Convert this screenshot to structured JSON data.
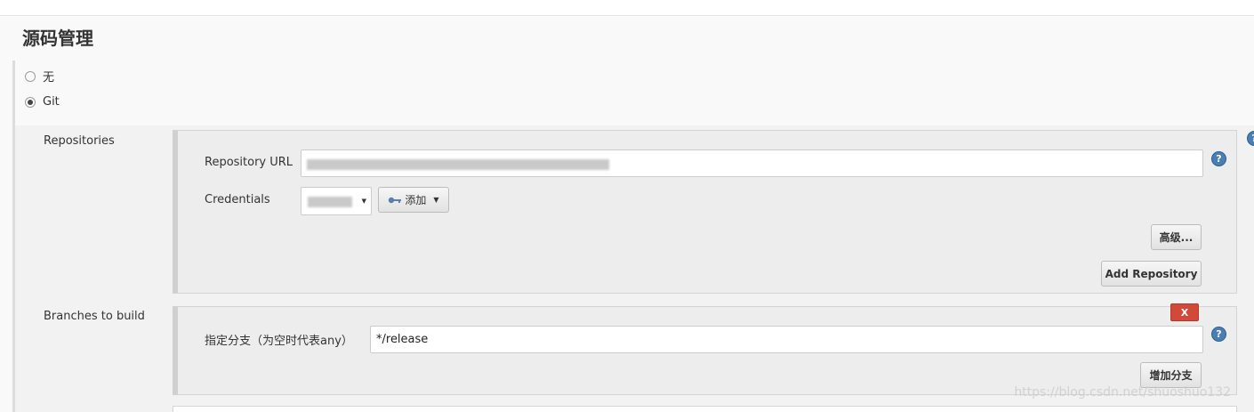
{
  "section": {
    "title": "源码管理"
  },
  "scm_options": [
    {
      "label": "无",
      "selected": false
    },
    {
      "label": "Git",
      "selected": true
    }
  ],
  "repositories": {
    "label": "Repositories",
    "url_label": "Repository URL",
    "url_value": "",
    "credentials_label": "Credentials",
    "credentials_value": "",
    "add_button_label": "添加",
    "advanced_button_label": "高级...",
    "add_repository_label": "Add Repository"
  },
  "branches": {
    "label": "Branches to build",
    "branch_specifier_label": "指定分支（为空时代表any）",
    "branch_specifier_value": "*/release",
    "delete_label": "X",
    "add_branch_label": "增加分支"
  },
  "watermark": "https://blog.csdn.net/shuoshuo132",
  "colors": {
    "help_icon": "#4a7fb5",
    "delete_button": "#d24939",
    "key_icon": "#5b7fa8"
  },
  "icons": {
    "help": "help-icon",
    "key": "key-icon",
    "dropdown": "caret-down-icon"
  }
}
